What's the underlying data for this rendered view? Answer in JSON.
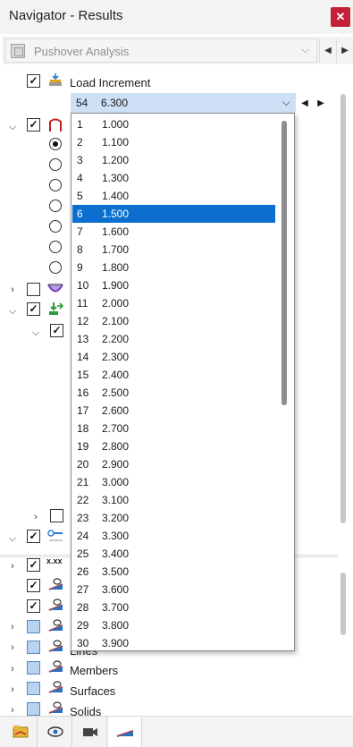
{
  "window": {
    "title": "Navigator - Results",
    "close_label": "✕"
  },
  "toolbar": {
    "analysis_label": "Pushover Analysis"
  },
  "load_increment": {
    "label": "Load Increment",
    "current_number": "54",
    "current_value": "6.300"
  },
  "dropdown": {
    "selected_index": 5,
    "items": [
      {
        "n": "1",
        "v": "1.000"
      },
      {
        "n": "2",
        "v": "1.100"
      },
      {
        "n": "3",
        "v": "1.200"
      },
      {
        "n": "4",
        "v": "1.300"
      },
      {
        "n": "5",
        "v": "1.400"
      },
      {
        "n": "6",
        "v": "1.500"
      },
      {
        "n": "7",
        "v": "1.600"
      },
      {
        "n": "8",
        "v": "1.700"
      },
      {
        "n": "9",
        "v": "1.800"
      },
      {
        "n": "10",
        "v": "1.900"
      },
      {
        "n": "11",
        "v": "2.000"
      },
      {
        "n": "12",
        "v": "2.100"
      },
      {
        "n": "13",
        "v": "2.200"
      },
      {
        "n": "14",
        "v": "2.300"
      },
      {
        "n": "15",
        "v": "2.400"
      },
      {
        "n": "16",
        "v": "2.500"
      },
      {
        "n": "17",
        "v": "2.600"
      },
      {
        "n": "18",
        "v": "2.700"
      },
      {
        "n": "19",
        "v": "2.800"
      },
      {
        "n": "20",
        "v": "2.900"
      },
      {
        "n": "21",
        "v": "3.000"
      },
      {
        "n": "22",
        "v": "3.100"
      },
      {
        "n": "23",
        "v": "3.200"
      },
      {
        "n": "24",
        "v": "3.300"
      },
      {
        "n": "25",
        "v": "3.400"
      },
      {
        "n": "26",
        "v": "3.500"
      },
      {
        "n": "27",
        "v": "3.600"
      },
      {
        "n": "28",
        "v": "3.700"
      },
      {
        "n": "29",
        "v": "3.800"
      },
      {
        "n": "30",
        "v": "3.900"
      }
    ]
  },
  "tree": {
    "xxx_label": "x.xx",
    "lines_label": "Lines",
    "members_label": "Members",
    "surfaces_label": "Surfaces",
    "solids_label": "Solids"
  },
  "colors": {
    "accent": "#0c6fcf",
    "combo_bg": "#cde0f5",
    "close": "#c4203a"
  }
}
